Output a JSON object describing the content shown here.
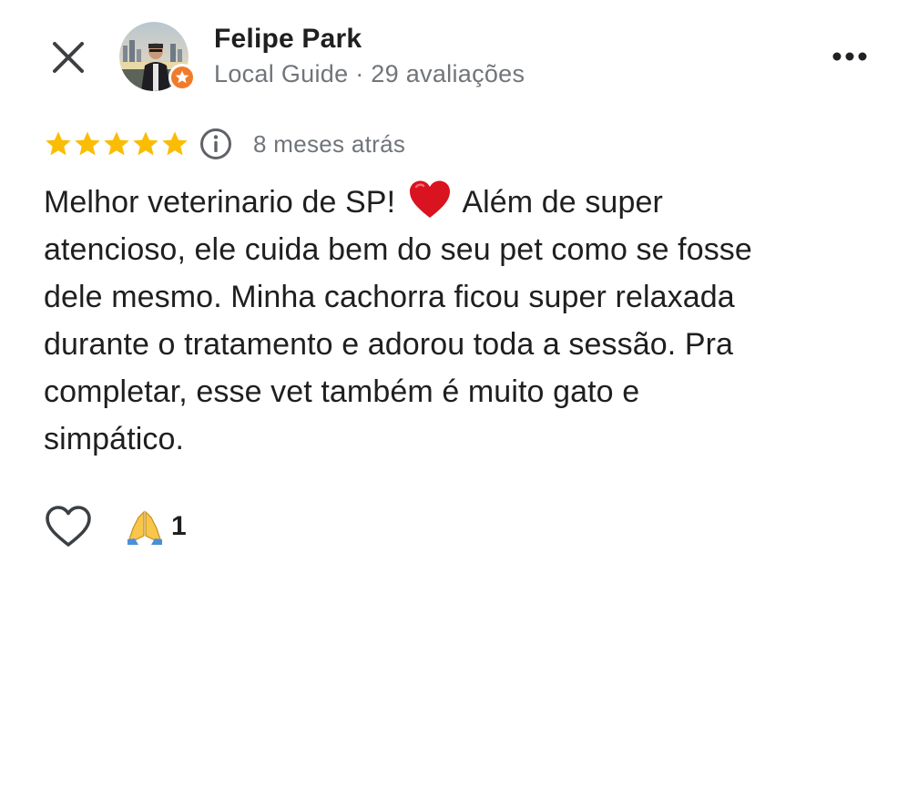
{
  "header": {
    "close_icon": "close-icon",
    "more_icon": "more-horizontal-icon"
  },
  "reviewer": {
    "name": "Felipe Park",
    "meta": "Local Guide · 29 avaliações",
    "avatar_icon": "avatar",
    "badge_icon": "local-guide-star-icon",
    "badge_color": "#f07b2b"
  },
  "rating": {
    "stars": 5,
    "max_stars": 5,
    "star_color": "#fbbc04",
    "info_icon": "info-icon",
    "time_ago": "8 meses atrás"
  },
  "review": {
    "lines": [
      {
        "before": "Melhor veterinario de SP! ",
        "emoji": "red-heart",
        "after": " Além de super"
      },
      {
        "text": "atencioso, ele cuida bem do seu pet como se fosse"
      },
      {
        "text": "dele mesmo. Minha cachorra ficou super relaxada"
      },
      {
        "text": "durante o tratamento e adorou toda a sessão. Pra"
      },
      {
        "text": "completar, esse vet também é muito gato e"
      },
      {
        "text": "simpático."
      }
    ]
  },
  "actions": {
    "like_icon": "heart-outline-icon",
    "reaction_icon": "folded-hands-emoji",
    "reaction_count": "1"
  }
}
